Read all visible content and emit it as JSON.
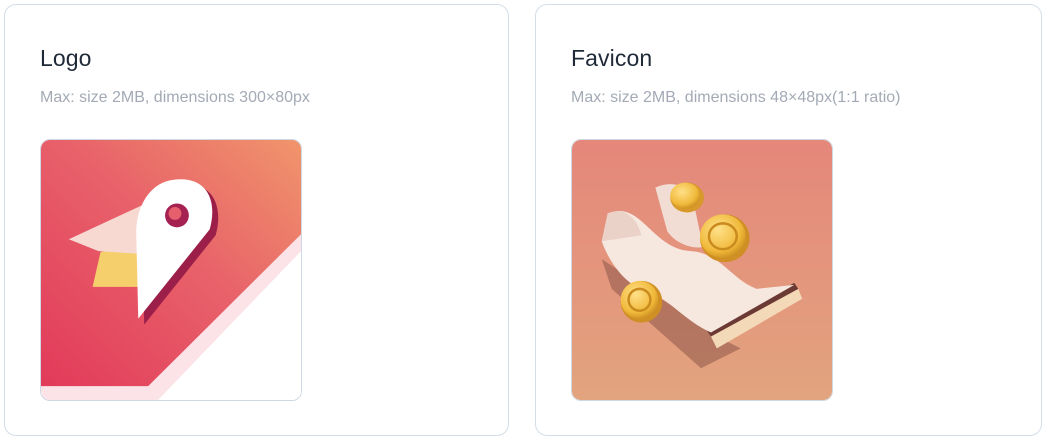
{
  "logo": {
    "title": "Logo",
    "hint": "Max: size 2MB, dimensions 300×80px",
    "image_icon": "map-pin-bird-logo-icon"
  },
  "favicon": {
    "title": "Favicon",
    "hint": "Max: size 2MB, dimensions 48×48px(1:1 ratio)",
    "image_icon": "receipt-coins-favicon-icon"
  },
  "colors": {
    "card_border": "#d4dde8",
    "title": "#1f2937",
    "hint": "#a3aab5",
    "logo_gradient_start": "#e23a5a",
    "logo_gradient_end": "#f0956b",
    "favicon_bg_top": "#e58778",
    "favicon_bg_bottom": "#e2a47e",
    "coin_gold": "#f0b93a"
  }
}
